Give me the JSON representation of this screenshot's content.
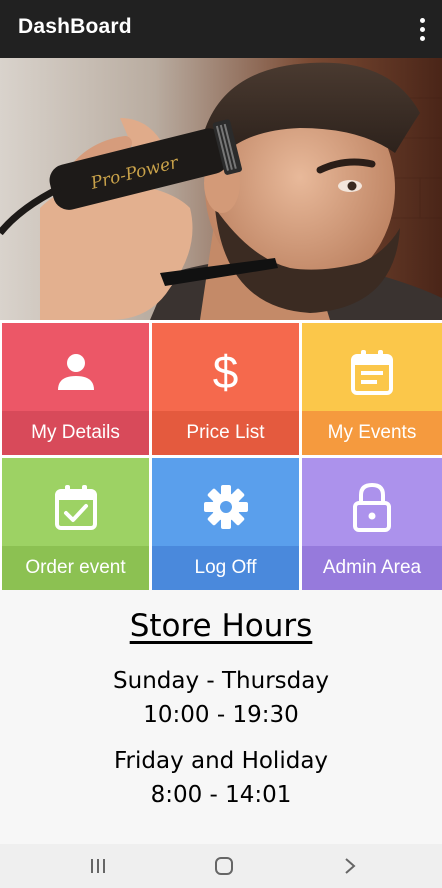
{
  "appbar": {
    "title": "DashBoard",
    "menu_icon": "more-vert-icon"
  },
  "hero": {
    "clipper_brand": "Pro-Power"
  },
  "tiles": [
    {
      "label": "My Details",
      "icon": "person-icon",
      "color": "#ec5767",
      "band": "#d84a5a"
    },
    {
      "label": "Price List",
      "icon": "dollar-icon",
      "color": "#f5694d",
      "band": "#e45a3e"
    },
    {
      "label": "My Events",
      "icon": "calendar-icon",
      "color": "#fbc74a",
      "band": "#f59a3e"
    },
    {
      "label": "Order event",
      "icon": "calendar-check-icon",
      "color": "#9dd264",
      "band": "#8cc152"
    },
    {
      "label": "Log Off",
      "icon": "gear-icon",
      "color": "#5a9fec",
      "band": "#4a89dc"
    },
    {
      "label": "Admin Area",
      "icon": "lock-icon",
      "color": "#ac92ec",
      "band": "#967adc"
    }
  ],
  "hours": {
    "title": "Store Hours",
    "lines": [
      "Sunday - Thursday",
      "10:00 - 19:30",
      "Friday and Holiday",
      "8:00 - 14:01"
    ]
  },
  "navbar": {
    "recents": "recents-icon",
    "home": "home-icon",
    "back": "back-icon"
  }
}
